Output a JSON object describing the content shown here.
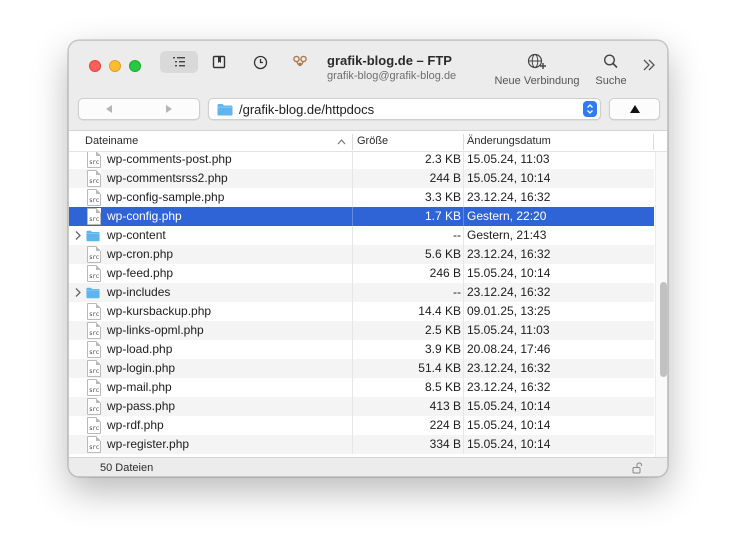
{
  "window": {
    "title": "grafik-blog.de – FTP",
    "subtitle": "grafik-blog@grafik-blog.de"
  },
  "toolbar": {
    "new_connection_label": "Neue Verbindung",
    "search_label": "Suche"
  },
  "path": {
    "value": "/grafik-blog.de/httpdocs"
  },
  "columns": {
    "name": "Dateiname",
    "size": "Größe",
    "modified": "Änderungsdatum"
  },
  "files": [
    {
      "name": "wp-comments-post.php",
      "size": "2.3 KB",
      "modified": "15.05.24, 11:03",
      "type": "file"
    },
    {
      "name": "wp-commentsrss2.php",
      "size": "244 B",
      "modified": "15.05.24, 10:14",
      "type": "file"
    },
    {
      "name": "wp-config-sample.php",
      "size": "3.3 KB",
      "modified": "23.12.24, 16:32",
      "type": "file"
    },
    {
      "name": "wp-config.php",
      "size": "1.7 KB",
      "modified": "Gestern, 22:20",
      "type": "file",
      "selected": true
    },
    {
      "name": "wp-content",
      "size": "--",
      "modified": "Gestern, 21:43",
      "type": "folder"
    },
    {
      "name": "wp-cron.php",
      "size": "5.6 KB",
      "modified": "23.12.24, 16:32",
      "type": "file"
    },
    {
      "name": "wp-feed.php",
      "size": "246 B",
      "modified": "15.05.24, 10:14",
      "type": "file"
    },
    {
      "name": "wp-includes",
      "size": "--",
      "modified": "23.12.24, 16:32",
      "type": "folder"
    },
    {
      "name": "wp-kursbackup.php",
      "size": "14.4 KB",
      "modified": "09.01.25, 13:25",
      "type": "file"
    },
    {
      "name": "wp-links-opml.php",
      "size": "2.5 KB",
      "modified": "15.05.24, 11:03",
      "type": "file"
    },
    {
      "name": "wp-load.php",
      "size": "3.9 KB",
      "modified": "20.08.24, 17:46",
      "type": "file"
    },
    {
      "name": "wp-login.php",
      "size": "51.4 KB",
      "modified": "23.12.24, 16:32",
      "type": "file"
    },
    {
      "name": "wp-mail.php",
      "size": "8.5 KB",
      "modified": "23.12.24, 16:32",
      "type": "file"
    },
    {
      "name": "wp-pass.php",
      "size": "413 B",
      "modified": "15.05.24, 10:14",
      "type": "file"
    },
    {
      "name": "wp-rdf.php",
      "size": "224 B",
      "modified": "15.05.24, 10:14",
      "type": "file"
    },
    {
      "name": "wp-register.php",
      "size": "334 B",
      "modified": "15.05.24, 10:14",
      "type": "file"
    }
  ],
  "file_icon_label": "src",
  "status": {
    "count_text": "50 Dateien"
  },
  "scroll": {
    "position_fraction": 0.62
  },
  "colors": {
    "selection": "#2f64d6",
    "folder": "#5fb4ee",
    "accent": "#2f7cf6"
  }
}
